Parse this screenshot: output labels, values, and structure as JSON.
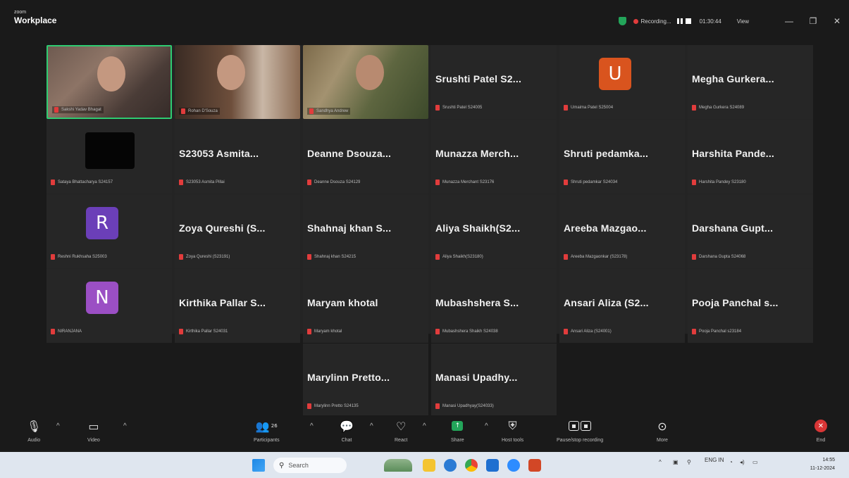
{
  "app": {
    "brand_small": "zoom",
    "brand_title": "Workplace"
  },
  "titlebar": {
    "recording_label": "Recording...",
    "timer": "01:30:44",
    "view_label": "View",
    "minimize": "—",
    "restore": "❐",
    "close": "✕"
  },
  "participants": [
    {
      "tile_name": "",
      "label": "Sakshi Yadav Bhagat",
      "type": "video"
    },
    {
      "tile_name": "",
      "label": "Rohan D'Souza",
      "type": "video"
    },
    {
      "tile_name": "",
      "label": "Sandhya Andrew",
      "type": "video"
    },
    {
      "tile_name": "Srushti Patel S2...",
      "label": "Srushti Patel S24005",
      "type": "name"
    },
    {
      "tile_name": "",
      "label": "Umaima Patel S25004",
      "type": "avatar",
      "initial": "U",
      "avatar_color": "#d9541e"
    },
    {
      "tile_name": "Megha Gurkera...",
      "label": "Megha Gurkera S24089",
      "type": "name"
    },
    {
      "tile_name": "",
      "label": "Sataya Bhattacharya S24157",
      "type": "blank"
    },
    {
      "tile_name": "S23053 Asmita...",
      "label": "S23053 Asmita Pillai",
      "type": "name"
    },
    {
      "tile_name": "Deanne Dsouza...",
      "label": "Deanne Dsouza S24129",
      "type": "name"
    },
    {
      "tile_name": "Munazza Merch...",
      "label": "Munazza Merchant S23176",
      "type": "name"
    },
    {
      "tile_name": "Shruti pedamka...",
      "label": "Shruti pedamkar S24034",
      "type": "name"
    },
    {
      "tile_name": "Harshita Pande...",
      "label": "Harshita Pandey S23180",
      "type": "name"
    },
    {
      "tile_name": "",
      "label": "Reshni Rukhsaha S25003",
      "type": "avatar",
      "initial": "R",
      "avatar_color": "#6b3fb8"
    },
    {
      "tile_name": "Zoya Qureshi (S...",
      "label": "Zoya Qureshi (S23191)",
      "type": "name"
    },
    {
      "tile_name": "Shahnaj khan S...",
      "label": "Shahnaj khan S24215",
      "type": "name"
    },
    {
      "tile_name": "Aliya Shaikh(S2...",
      "label": "Aliya Shaikh(S23180)",
      "type": "name"
    },
    {
      "tile_name": "Areeba Mazgao...",
      "label": "Areeba Mazgaonkar (S23178)",
      "type": "name"
    },
    {
      "tile_name": "Darshana Gupt...",
      "label": "Darshana Gupta S24068",
      "type": "name"
    },
    {
      "tile_name": "",
      "label": "NIRANJANA",
      "type": "avatar",
      "initial": "N",
      "avatar_color": "#9b4fc4"
    },
    {
      "tile_name": "Kirthika Pallar S...",
      "label": "Kirthika Pallar S24031",
      "type": "name"
    },
    {
      "tile_name": "Maryam khotal",
      "label": "Maryam khotal",
      "type": "name"
    },
    {
      "tile_name": "Mubashshera S...",
      "label": "Mubashshera Shaikh S24038",
      "type": "name"
    },
    {
      "tile_name": "Ansari Aliza (S2...",
      "label": "Ansari Aliza (S24001)",
      "type": "name"
    },
    {
      "tile_name": "Pooja Panchal s...",
      "label": "Pooja Panchal s23184",
      "type": "name"
    },
    {
      "tile_name": "Marylinn Pretto...",
      "label": "Marylinn Pretto S24135",
      "type": "name"
    },
    {
      "tile_name": "Manasi Upadhy...",
      "label": "Manasi Upadhyay(S24033)",
      "type": "name"
    }
  ],
  "toolbar": {
    "audio": "Audio",
    "video": "Video",
    "participants": "Participants",
    "participants_count": "26",
    "chat": "Chat",
    "react": "React",
    "share": "Share",
    "host_tools": "Host tools",
    "pause_recording": "Pause/stop recording",
    "more": "More",
    "end": "End"
  },
  "taskbar": {
    "search_placeholder": "Search",
    "weather": "ENG IN",
    "time": "14:55",
    "date": "11-12-2024"
  },
  "colors": {
    "active_speaker": "#2ecc71",
    "mute": "#e13c3c",
    "end": "#d93636",
    "share": "#23a55a"
  }
}
